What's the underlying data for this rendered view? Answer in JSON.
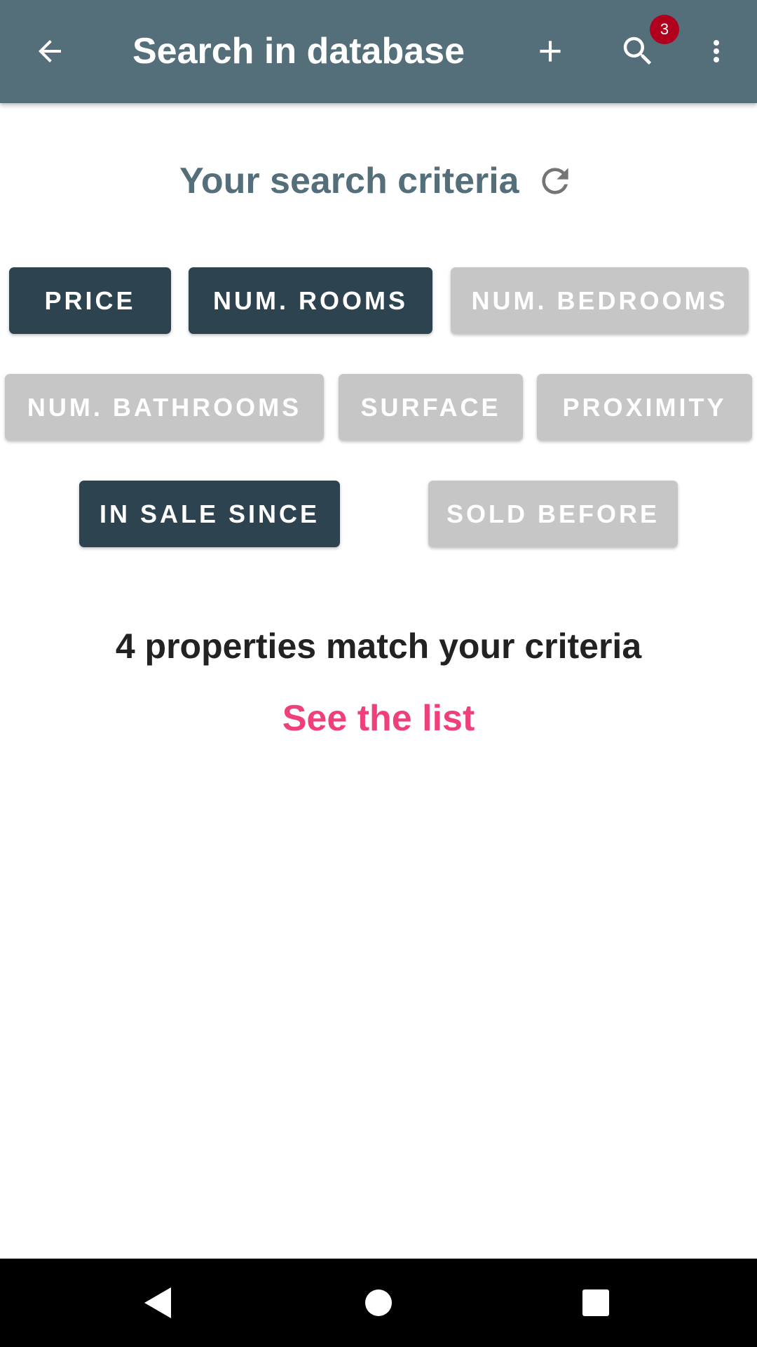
{
  "app_bar": {
    "title": "Search in database",
    "search_badge_count": "3",
    "background_color": "#546e7a",
    "icons": {
      "back": "arrow-back-icon",
      "add": "add-icon",
      "search": "search-icon",
      "more": "more-vert-icon"
    }
  },
  "criteria": {
    "heading": "Your search criteria",
    "refresh_icon": "refresh-icon",
    "chips": [
      {
        "label": "PRICE",
        "selected": true
      },
      {
        "label": "NUM. ROOMS",
        "selected": true
      },
      {
        "label": "NUM. BEDROOMS",
        "selected": false
      },
      {
        "label": "NUM. BATHROOMS",
        "selected": false
      },
      {
        "label": "SURFACE",
        "selected": false
      },
      {
        "label": "PROXIMITY",
        "selected": false
      },
      {
        "label": "IN SALE SINCE",
        "selected": true
      },
      {
        "label": "SOLD BEFORE",
        "selected": false
      }
    ],
    "selected_color": "#2d4350",
    "unselected_color": "#c6c6c6"
  },
  "results": {
    "match_text": "4 properties match your criteria",
    "see_list_label": "See the list",
    "link_color": "#ef407a"
  },
  "system_nav": {
    "icons": {
      "back": "nav-back-icon",
      "home": "nav-home-icon",
      "recents": "nav-recents-icon"
    }
  }
}
